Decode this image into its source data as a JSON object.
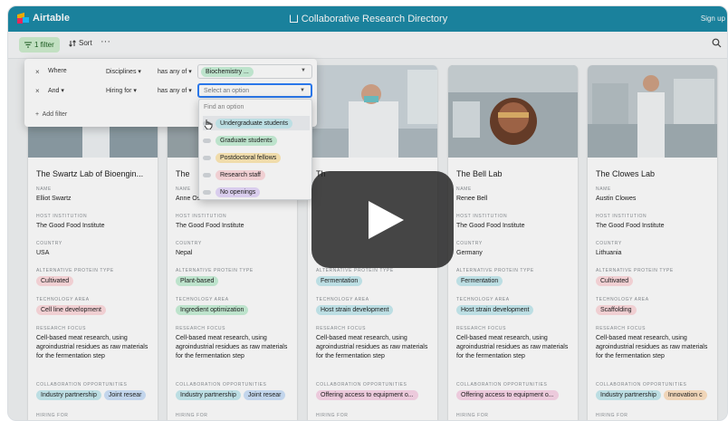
{
  "app": {
    "brand": "Airtable",
    "title": "Collaborative Research Directory",
    "signup": "Sign up",
    "colors": {
      "topbar": "#1c8aa6",
      "filter_active": "#cfefcf",
      "play": "#1e1e1e"
    }
  },
  "toolbar": {
    "filter_label": "1 filter",
    "sort_label": "Sort",
    "more_label": "···",
    "icons": [
      "filter-icon",
      "sort-icon",
      "search-icon"
    ]
  },
  "filter_panel": {
    "rows": [
      {
        "remove": "×",
        "conjunction": "Where",
        "field": "Disciplines",
        "operator": "has any of",
        "value_chip": "Biochemistry",
        "value_suffix": "..."
      },
      {
        "remove": "×",
        "conjunction": "And",
        "field": "Hiring for",
        "operator": "has any of",
        "placeholder": "Select an option"
      }
    ],
    "add_filter": "Add filter"
  },
  "dropdown": {
    "search_placeholder": "Find an option",
    "options": [
      {
        "label": "Undergraduate students",
        "color": "c-teal"
      },
      {
        "label": "Graduate students",
        "color": "c-green"
      },
      {
        "label": "Postdoctoral fellows",
        "color": "c-yellow"
      },
      {
        "label": "Research staff",
        "color": "c-red"
      },
      {
        "label": "No openings",
        "color": "c-purple"
      }
    ]
  },
  "labels": {
    "name": "NAME",
    "host": "HOST INSTITUTION",
    "country": "COUNTRY",
    "protein": "ALTERNATIVE PROTEIN TYPE",
    "tech": "TECHNOLOGY AREA",
    "focus": "RESEARCH FOCUS",
    "collab": "COLLABORATION OPPORTUNITIES",
    "hiring": "HIRING FOR"
  },
  "cards": [
    {
      "title": "The Swartz Lab of Bioengin...",
      "name": "Elliot Swartz",
      "host": "The Good Food Institute",
      "country": "USA",
      "protein": {
        "text": "Cultivated",
        "color": "c-red"
      },
      "tech": {
        "text": "Cell line development",
        "color": "c-red"
      },
      "focus": "Cell-based meat research, using agroindustrial residues as raw materials for the fermentation step",
      "collab": [
        {
          "text": "Industry partnership",
          "color": "c-teal"
        },
        {
          "text": "Joint resear",
          "color": "c-blue"
        }
      ]
    },
    {
      "title": "The",
      "name": "Anne Osborn",
      "host": "The Good Food Institute",
      "country": "Nepal",
      "protein": {
        "text": "Plant-based",
        "color": "c-green"
      },
      "tech": {
        "text": "Ingredient optimization",
        "color": "c-green"
      },
      "focus": "Cell-based meat research, using agroindustrial residues as raw materials for the fermentation step",
      "collab": [
        {
          "text": "Industry partnership",
          "color": "c-teal"
        },
        {
          "text": "Joint resear",
          "color": "c-blue"
        }
      ]
    },
    {
      "title": "Th",
      "name": "",
      "host": "",
      "country": "",
      "protein": {
        "text": "Fermentation",
        "color": "c-teal"
      },
      "tech": {
        "text": "Host strain development",
        "color": "c-teal"
      },
      "focus": "Cell-based meat research, using agroindustrial residues as raw materials for the fermentation step",
      "collab": [
        {
          "text": "Offering access to equipment o...",
          "color": "c-pink"
        }
      ]
    },
    {
      "title": "The Bell Lab",
      "name": "Renee Bell",
      "host": "The Good Food Institute",
      "country": "Germany",
      "protein": {
        "text": "Fermentation",
        "color": "c-teal"
      },
      "tech": {
        "text": "Host strain development",
        "color": "c-teal"
      },
      "focus": "Cell-based meat research, using agroindustrial residues as raw materials for the fermentation step",
      "collab": [
        {
          "text": "Offering access to equipment o...",
          "color": "c-pink"
        }
      ]
    },
    {
      "title": "The Clowes Lab",
      "name": "Austin Clowes",
      "host": "The Good Food Institute",
      "country": "Lithuania",
      "protein": {
        "text": "Cultivated",
        "color": "c-red"
      },
      "tech": {
        "text": "Scaffolding",
        "color": "c-red"
      },
      "focus": "Cell-based meat research, using agroindustrial residues as raw materials for the fermentation step",
      "collab": [
        {
          "text": "Industry partnership",
          "color": "c-teal"
        },
        {
          "text": "Innovation c",
          "color": "c-orange"
        }
      ]
    }
  ],
  "video": {
    "icon": "play-icon"
  }
}
